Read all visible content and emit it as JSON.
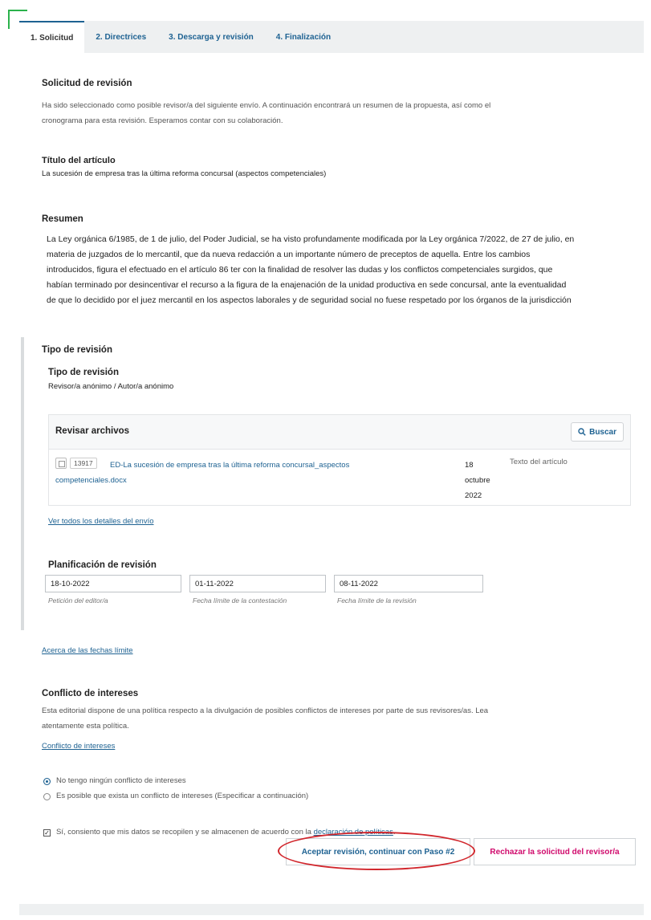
{
  "tabs": [
    {
      "label": "1. Solicitud",
      "active": true
    },
    {
      "label": "2. Directrices",
      "active": false
    },
    {
      "label": "3. Descarga y revisión",
      "active": false
    },
    {
      "label": "4. Finalización",
      "active": false
    }
  ],
  "request": {
    "heading": "Solicitud de revisión",
    "intro_line1": "Ha sido seleccionado como posible revisor/a del siguiente envío. A continuación encontrará un resumen de la propuesta, así como el",
    "intro_line2": "cronograma para esta revisión. Esperamos contar con su colaboración."
  },
  "article": {
    "title_label": "Título del artículo",
    "title": "La sucesión de empresa tras la última reforma concursal (aspectos competenciales)"
  },
  "abstract": {
    "label": "Resumen",
    "lines": [
      "La Ley orgánica 6/1985, de 1 de julio, del Poder Judicial, se ha visto profundamente modificada por la Ley orgánica 7/2022, de 27 de julio, en",
      "materia de juzgados de lo mercantil, que da nueva redacción a un importante número de preceptos de aquella. Entre los cambios",
      "introducidos, figura el efectuado en el artículo 86 ter con la finalidad de resolver las dudas y los conflictos competenciales surgidos, que",
      "habían terminado por desincentivar el recurso a la figura de la enajenación de la unidad productiva en sede concursal, ante la eventualidad",
      "de que lo decidido por el juez mercantil en los aspectos laborales y de seguridad social no fuese respetado por los órganos de la jurisdicción"
    ]
  },
  "review_type": {
    "outer_label": "Tipo de revisión",
    "label": "Tipo de revisión",
    "value": "Revisor/a anónimo / Autor/a anónimo"
  },
  "files": {
    "title": "Revisar archivos",
    "search_label": "Buscar",
    "rows": [
      {
        "id": "13917",
        "name_line1": "ED-La sucesión de empresa tras la última reforma concursal_aspectos",
        "name_line2": "competenciales.docx",
        "date_line1": "18",
        "date_line2": "octubre",
        "date_line3": "2022",
        "type": "Texto del artículo"
      }
    ]
  },
  "links": {
    "view_details": "Ver todos los detalles del envío",
    "about_deadlines": "Acerca de las fechas límite",
    "conflict": "Conflicto de intereses",
    "policy": "declaración de políticas"
  },
  "schedule": {
    "heading": "Planificación de revisión",
    "fields": [
      {
        "value": "18-10-2022",
        "caption": "Petición del editor/a"
      },
      {
        "value": "01-11-2022",
        "caption": "Fecha límite de la contestación"
      },
      {
        "value": "08-11-2022",
        "caption": "Fecha límite de la revisión"
      }
    ]
  },
  "conflict": {
    "heading": "Conflicto de intereses",
    "text_line1": "Esta editorial dispone de una política respecto a la divulgación de posibles conflictos de intereses por parte de sus revisores/as. Lea",
    "text_line2": "atentamente esta política.",
    "option_none": "No tengo ningún conflicto de intereses",
    "option_possible": "Es posible que exista un conflicto de intereses (Especificar a continuación)",
    "selected": "none"
  },
  "consent": {
    "text": "Sí, consiento que mis datos se recopilen y se almacenen de acuerdo con la",
    "suffix": ".",
    "checked": true
  },
  "actions": {
    "accept_label": "Aceptar revisión, continuar con Paso #2",
    "reject_label": "Rechazar la solicitud del revisor/a"
  },
  "colors": {
    "accent": "#1e6292",
    "reject": "#d00a6c",
    "highlight": "#d1262c",
    "corner": "#2bb24c"
  }
}
